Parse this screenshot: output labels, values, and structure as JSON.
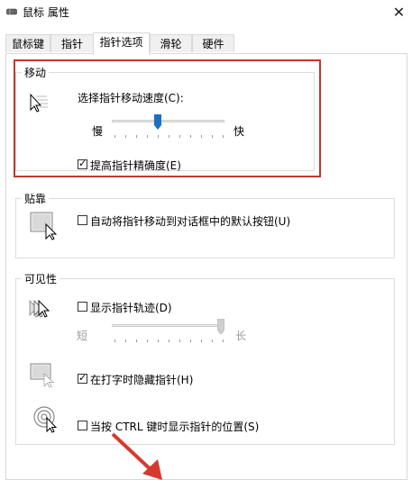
{
  "window": {
    "title": "鼠标 属性",
    "close_glyph": "✕"
  },
  "tabs": [
    {
      "label": "鼠标键"
    },
    {
      "label": "指针"
    },
    {
      "label": "指针选项"
    },
    {
      "label": "滑轮"
    },
    {
      "label": "硬件"
    }
  ],
  "active_tab": "指针选项",
  "motion": {
    "legend": "移动",
    "speed_label": "选择指针移动速度(C):",
    "slow_label": "慢",
    "fast_label": "快",
    "speed_level": 0.4,
    "precision_label": "提高指针精确度(E)",
    "precision_checked": true
  },
  "snap": {
    "legend": "贴靠",
    "snap_label": "自动将指针移动到对话框中的默认按钮(U)",
    "snap_checked": false
  },
  "visibility": {
    "legend": "可见性",
    "trails_label": "显示指针轨迹(D)",
    "trails_checked": false,
    "short_label": "短",
    "long_label": "长",
    "trails_level": 1.0,
    "hide_label": "在打字时隐藏指针(H)",
    "hide_checked": true,
    "ctrl_label": "当按 CTRL 键时显示指针的位置(S)",
    "ctrl_checked": false
  },
  "colors": {
    "highlight": "#c0392b",
    "thumb": "#1e6fbf",
    "arrow": "#d63a2f"
  }
}
